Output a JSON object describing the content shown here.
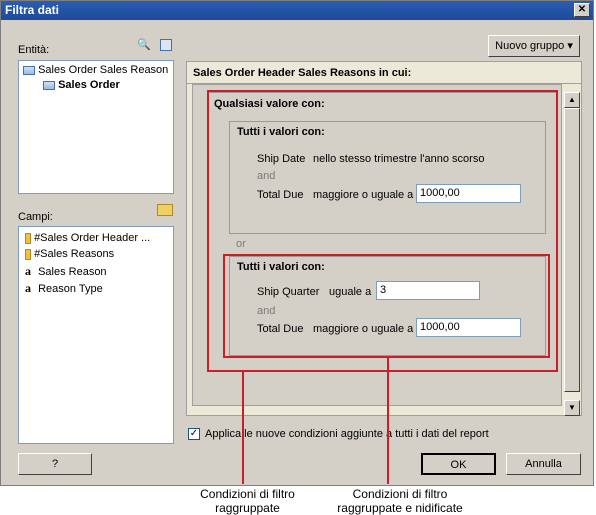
{
  "window": {
    "title": "Filtra dati"
  },
  "entities": {
    "label": "Entità:",
    "items": [
      "Sales Order Sales Reason",
      "Sales Order"
    ]
  },
  "fields": {
    "label": "Campi:",
    "items": [
      "#Sales Order Header ...",
      "#Sales Reasons",
      "Sales Reason",
      "Reason Type"
    ]
  },
  "toolbar": {
    "new_group": "Nuovo gruppo"
  },
  "filter": {
    "header": "Sales Order Header Sales Reasons in cui:",
    "outer_group_title": "Qualsiasi valore con:",
    "group1": {
      "title": "Tutti i valori con:",
      "row1_field": "Ship Date",
      "row1_op": "nello stesso trimestre l'anno scorso",
      "and": "and",
      "row2_field": "Total Due",
      "row2_op": "maggiore o uguale a",
      "row2_value": "1000,00"
    },
    "or": "or",
    "group2": {
      "title": "Tutti i valori con:",
      "row1_field": "Ship Quarter",
      "row1_op": "uguale a",
      "row1_value": "3",
      "and": "and",
      "row2_field": "Total Due",
      "row2_op": "maggiore o uguale a",
      "row2_value": "1000,00"
    }
  },
  "apply_checkbox": {
    "label": "Applica le nuove condizioni aggiunte a tutti i dati del report",
    "checked": true
  },
  "buttons": {
    "help": "?",
    "ok": "OK",
    "cancel": "Annulla"
  },
  "callouts": {
    "left_line1": "Condizioni di filtro",
    "left_line2": "raggruppate",
    "right_line1": "Condizioni di filtro",
    "right_line2": "raggruppate e nidificate"
  },
  "colors": {
    "title_bar": "#1e4a9a",
    "callout_red": "#c8202a"
  }
}
